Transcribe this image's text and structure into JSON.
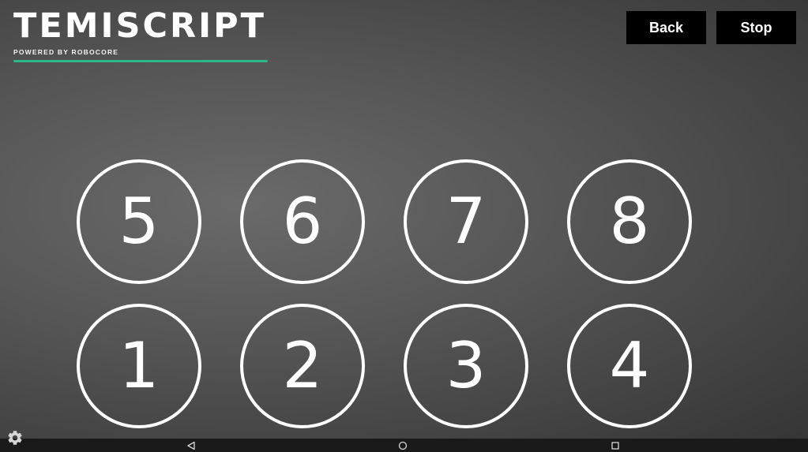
{
  "app": {
    "title": "TEMISCRIPT",
    "subtitle": "POWERED BY ROBOCORE",
    "accent_color": "#2bb989"
  },
  "toolbar": {
    "back_label": "Back",
    "stop_label": "Stop"
  },
  "pads": {
    "top_row": [
      "5",
      "6",
      "7",
      "8"
    ],
    "bottom_row": [
      "1",
      "2",
      "3",
      "4"
    ]
  },
  "icons": {
    "settings": "gear-icon",
    "nav_back": "triangle-back-icon",
    "nav_home": "circle-home-icon",
    "nav_recents": "square-recents-icon"
  }
}
